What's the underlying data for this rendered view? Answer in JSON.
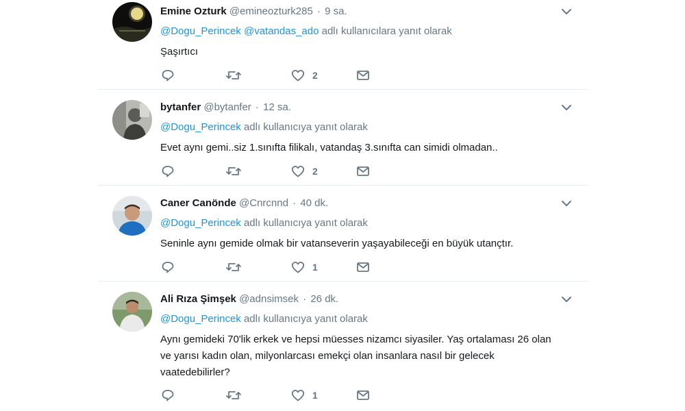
{
  "tweets": [
    {
      "name": "Emine Ozturk",
      "handle": "@emineozturk285",
      "separator": "·",
      "time": "9 sa.",
      "mentions": [
        "@Dogu_Perincek",
        "@vatandas_ado"
      ],
      "reply_suffix": "adlı kullanıcılara yanıt olarak",
      "text": "Şaşırtıcı",
      "like_count": "2",
      "avatar_icon": "dark-night-landscape-avatar"
    },
    {
      "name": "bytanfer",
      "handle": "@bytanfer",
      "separator": "·",
      "time": "12 sa.",
      "mentions": [
        "@Dogu_Perincek"
      ],
      "reply_suffix": "adlı kullanıcıya yanıt olarak",
      "text": "Evet aynı gemi..siz 1.sınıfta filikalı, vatandaş 3.sınıfta can simidi olmadan..",
      "like_count": "2",
      "avatar_icon": "grayscale-person-avatar"
    },
    {
      "name": "Caner Canönde",
      "handle": "@Cnrcnnd",
      "separator": "·",
      "time": "40 dk.",
      "mentions": [
        "@Dogu_Perincek"
      ],
      "reply_suffix": "adlı kullanıcıya yanıt olarak",
      "text": "Seninle aynı gemide olmak bir vatanseverin yaşayabileceği en büyük utançtır.",
      "like_count": "1",
      "avatar_icon": "smiling-man-blue-shirt-avatar"
    },
    {
      "name": "Ali Rıza Şimşek",
      "handle": "@adnsimsek",
      "separator": "·",
      "time": "26 dk.",
      "mentions": [
        "@Dogu_Perincek"
      ],
      "reply_suffix": "adlı kullanıcıya yanıt olarak",
      "text": "Aynı gemideki 70'lik erkek ve hepsi müesses nizamcı siyasiler. Yaş ortalaması 26 olan ve yarısı kadın olan, milyonlarcası emekçi olan insanlara nasıl bir gelecek vaatedebilirler?",
      "like_count": "1",
      "avatar_icon": "man-outdoors-avatar"
    }
  ],
  "icons": {
    "reply": "reply-icon",
    "retweet": "retweet-icon",
    "like": "heart-icon",
    "dm": "envelope-icon",
    "more": "chevron-down-icon"
  },
  "colors": {
    "link": "#1b95e0",
    "secondary_text": "#657786",
    "divider": "#e6ecf0"
  }
}
